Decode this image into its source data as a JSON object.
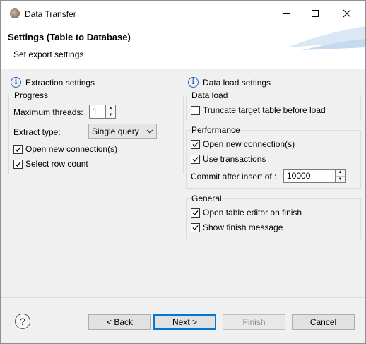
{
  "window": {
    "title": "Data Transfer"
  },
  "banner": {
    "title": "Settings (Table to Database)",
    "subtitle": "Set export settings"
  },
  "extraction": {
    "heading": "Extraction settings",
    "progress_group": "Progress",
    "max_threads_label": "Maximum threads:",
    "max_threads_value": "1",
    "extract_type_label": "Extract type:",
    "extract_type_value": "Single query",
    "open_new_connection": {
      "label": "Open new connection(s)",
      "checked": true
    },
    "select_row_count": {
      "label": "Select row count",
      "checked": true
    }
  },
  "data_load": {
    "heading": "Data load settings",
    "data_load_group": "Data load",
    "truncate": {
      "label": "Truncate target table before load",
      "checked": false
    },
    "performance_group": "Performance",
    "open_new_connection": {
      "label": "Open new connection(s)",
      "checked": true
    },
    "use_transactions": {
      "label": "Use transactions",
      "checked": true
    },
    "commit_label": "Commit after insert of :",
    "commit_value": "10000",
    "general_group": "General",
    "open_editor": {
      "label": "Open table editor on finish",
      "checked": true
    },
    "show_finish": {
      "label": "Show finish message",
      "checked": true
    }
  },
  "footer": {
    "help_glyph": "?",
    "back": "< Back",
    "next": "Next >",
    "finish": "Finish",
    "cancel": "Cancel"
  }
}
